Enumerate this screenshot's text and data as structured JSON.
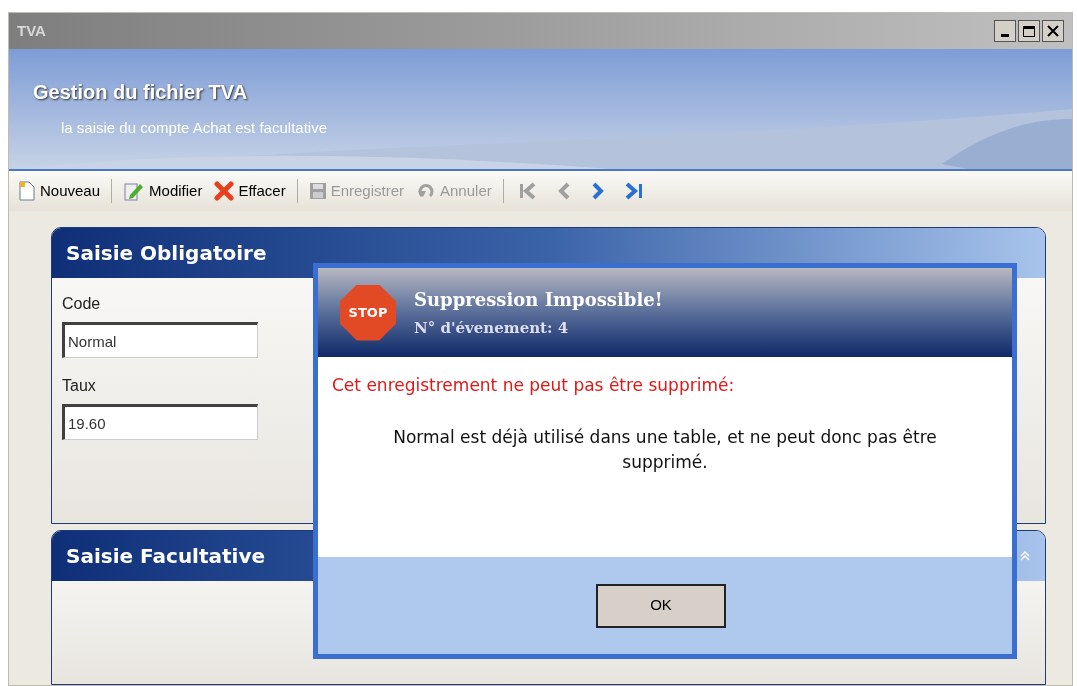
{
  "window": {
    "title": "TVA"
  },
  "header": {
    "title": "Gestion du fichier TVA",
    "subtitle": "la saisie du compte Achat est facultative"
  },
  "toolbar": [
    {
      "kind": "new",
      "label": "Nouveau",
      "disabled": false,
      "separator_after": true
    },
    {
      "kind": "edit",
      "label": "Modifier",
      "disabled": false,
      "separator_after": false
    },
    {
      "kind": "delete",
      "label": "Effacer",
      "disabled": false,
      "separator_after": true
    },
    {
      "kind": "save",
      "label": "Enregistrer",
      "disabled": true,
      "separator_after": false
    },
    {
      "kind": "undo",
      "label": "Annuler",
      "disabled": true,
      "separator_after": true
    },
    {
      "kind": "first",
      "disabled": true,
      "separator_after": false
    },
    {
      "kind": "prev",
      "disabled": true,
      "separator_after": false
    },
    {
      "kind": "next",
      "disabled": false,
      "separator_after": false
    },
    {
      "kind": "last",
      "disabled": false,
      "separator_after": false
    }
  ],
  "panels": [
    {
      "title": "Saisie Obligatoire",
      "collapsible": false,
      "fields": [
        {
          "label": "Code",
          "value": "Normal"
        },
        {
          "label": "Taux",
          "value": "19.60"
        }
      ]
    },
    {
      "title": "Saisie Facultative",
      "collapsible": true
    }
  ],
  "dialog": {
    "icon_text": "STOP",
    "title": "Suppression Impossible!",
    "subtitle": "N° d'évenement: 4",
    "error": "Cet enregistrement ne peut pas être supprimé:",
    "message": "Normal est déjà utilisé dans une table, et ne peut donc pas être supprimé.",
    "buttons": [
      "OK"
    ]
  }
}
